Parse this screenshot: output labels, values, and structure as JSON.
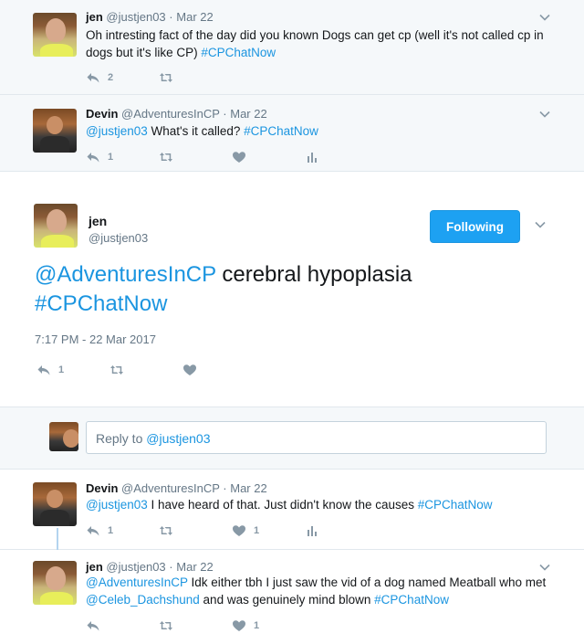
{
  "tweets": [
    {
      "name": "jen",
      "handle": "@justjen03",
      "dot": "·",
      "date": "Mar 22",
      "text_parts": [
        "Oh intresting fact of the day did you known Dogs can get cp (well it's not called cp in dogs but it's like CP) ",
        "#CPChatNow"
      ],
      "reply_count": "2"
    },
    {
      "name": "Devin",
      "handle": "@AdventuresInCP",
      "dot": "·",
      "date": "Mar 22",
      "text_parts": [
        "@justjen03",
        " What's it called? ",
        "#CPChatNow"
      ],
      "reply_count": "1"
    }
  ],
  "focus": {
    "name": "jen",
    "handle": "@justjen03",
    "follow_label": "Following",
    "text_parts": [
      "@AdventuresInCP",
      " cerebral hypoplasia ",
      "#CPChatNow"
    ],
    "timestamp": "7:17 PM - 22 Mar 2017",
    "reply_count": "1"
  },
  "reply_box": {
    "placeholder_prefix": "Reply to ",
    "placeholder_handle": "@justjen03"
  },
  "replies": [
    {
      "name": "Devin",
      "handle": "@AdventuresInCP",
      "dot": "·",
      "date": "Mar 22",
      "text_parts": [
        "@justjen03",
        " I have heard of that. Just didn't know the causes ",
        "#CPChatNow"
      ],
      "reply_count": "1",
      "like_count": "1"
    },
    {
      "name": "jen",
      "handle": "@justjen03",
      "dot": "·",
      "date": "Mar 22",
      "text_parts": [
        "@AdventuresInCP",
        " Idk either tbh I just saw the vid of a dog named Meatball who met ",
        "@Celeb_Dachshund",
        " and was genuinely mind blown ",
        "#CPChatNow"
      ],
      "like_count": "1"
    }
  ],
  "icons": [
    "reply-icon",
    "retweet-icon",
    "like-icon",
    "analytics-icon",
    "chevron-down-icon"
  ],
  "colors": {
    "link": "#1b95e0",
    "follow_bg": "#1da1f2",
    "thread_bg": "#f5f8fa",
    "muted": "#8899a6"
  }
}
